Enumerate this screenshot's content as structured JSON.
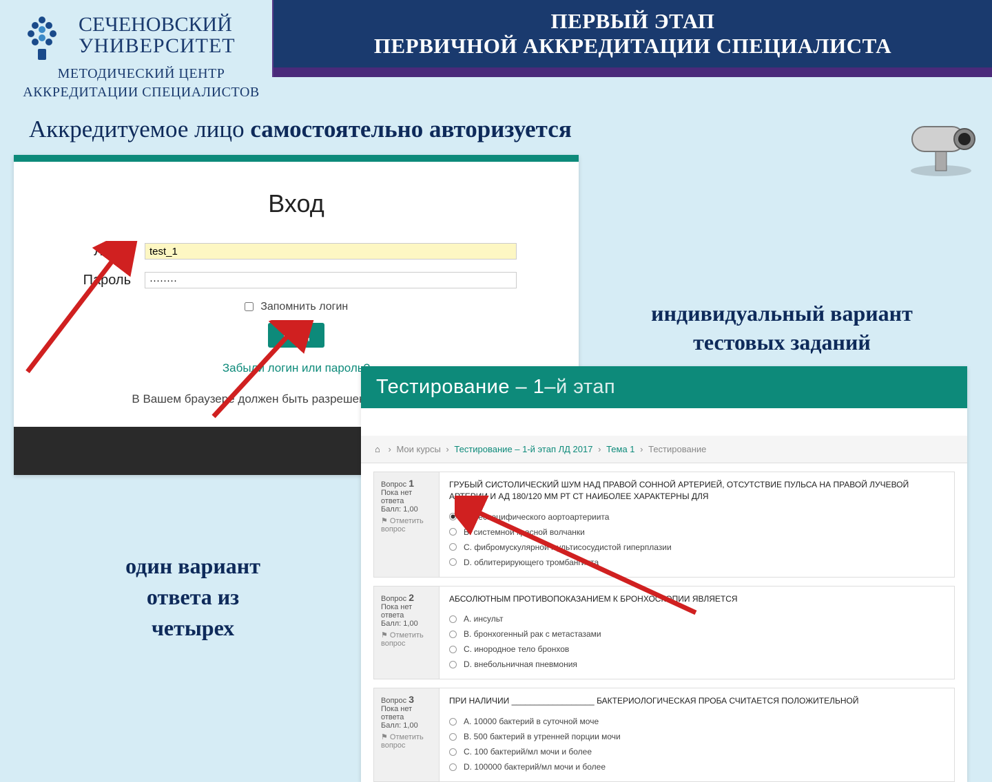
{
  "logo": {
    "line1": "СЕЧЕНОВСКИЙ",
    "line2": "УНИВЕРСИТЕТ",
    "sub1": "МЕТОДИЧЕСКИЙ ЦЕНТР",
    "sub2": "АККРЕДИТАЦИИ СПЕЦИАЛИСТОВ"
  },
  "title": {
    "line1": "ПЕРВЫЙ ЭТАП",
    "line2": "ПЕРВИЧНОЙ АККРЕДИТАЦИИ СПЕЦИАЛИСТА"
  },
  "main_heading": {
    "prefix": "Аккредитуемое лицо ",
    "bold": "самостоятельно авторизуется"
  },
  "login": {
    "title": "Вход",
    "label_login": "Логин",
    "label_password": "Пароль",
    "value_login": "test_1",
    "value_password": "········",
    "remember": "Запомнить логин",
    "button": "Вход",
    "forgot": "Забыли логин или пароль?",
    "cookies": "В Вашем браузере должен быть разрешен прием cookies ⓘ"
  },
  "annot_right": {
    "line1": "индивидуальный вариант",
    "line2": "тестовых заданий"
  },
  "annot_left": {
    "line1": "один вариант",
    "line2": "ответа из",
    "line3": "четырех"
  },
  "test": {
    "header_bold": "Тестирование – 1–",
    "header_thin": "й этап",
    "breadcrumb": {
      "b1": "Мои курсы",
      "b2": "Тестирование – 1-й этап ЛД 2017",
      "b3": "Тема 1",
      "b4": "Тестирование"
    },
    "questions": [
      {
        "num": "1",
        "status": "Пока нет ответа",
        "score": "Балл: 1,00",
        "flag": "⚑ Отметить вопрос",
        "text": "ГРУБЫЙ СИСТОЛИЧЕСКИЙ ШУМ НАД ПРАВОЙ СОННОЙ АРТЕРИЕЙ, ОТСУТСТВИЕ ПУЛЬСА НА ПРАВОЙ ЛУЧЕВОЙ АРТЕРИИ И АД 180/120 ММ РТ СТ НАИБОЛЕЕ ХАРАКТЕРНЫ ДЛЯ",
        "options": [
          "A. неспецифического аортоартериита",
          "B. системной красной волчанки",
          "C. фибромускулярной мультисосудистой гиперплазии",
          "D. облитерирующего тромбангиита"
        ],
        "selected": 0
      },
      {
        "num": "2",
        "status": "Пока нет ответа",
        "score": "Балл: 1,00",
        "flag": "⚑ Отметить вопрос",
        "text": "АБСОЛЮТНЫМ ПРОТИВОПОКАЗАНИЕМ К БРОНХОСКОПИИ ЯВЛЯЕТСЯ",
        "options": [
          "A. инсульт",
          "B. бронхогенный рак с метастазами",
          "C. инородное тело бронхов",
          "D. внебольничная пневмония"
        ],
        "selected": -1
      },
      {
        "num": "3",
        "status": "Пока нет ответа",
        "score": "Балл: 1,00",
        "flag": "⚑ Отметить вопрос",
        "text": "ПРИ НАЛИЧИИ __________________ БАКТЕРИОЛОГИЧЕСКАЯ ПРОБА СЧИТАЕТСЯ ПОЛОЖИТЕЛЬНОЙ",
        "options": [
          "A. 10000 бактерий в суточной моче",
          "B. 500 бактерий в утренней порции мочи",
          "C. 100 бактерий/мл мочи и более",
          "D. 100000 бактерий/мл мочи и более"
        ],
        "selected": -1
      }
    ]
  }
}
